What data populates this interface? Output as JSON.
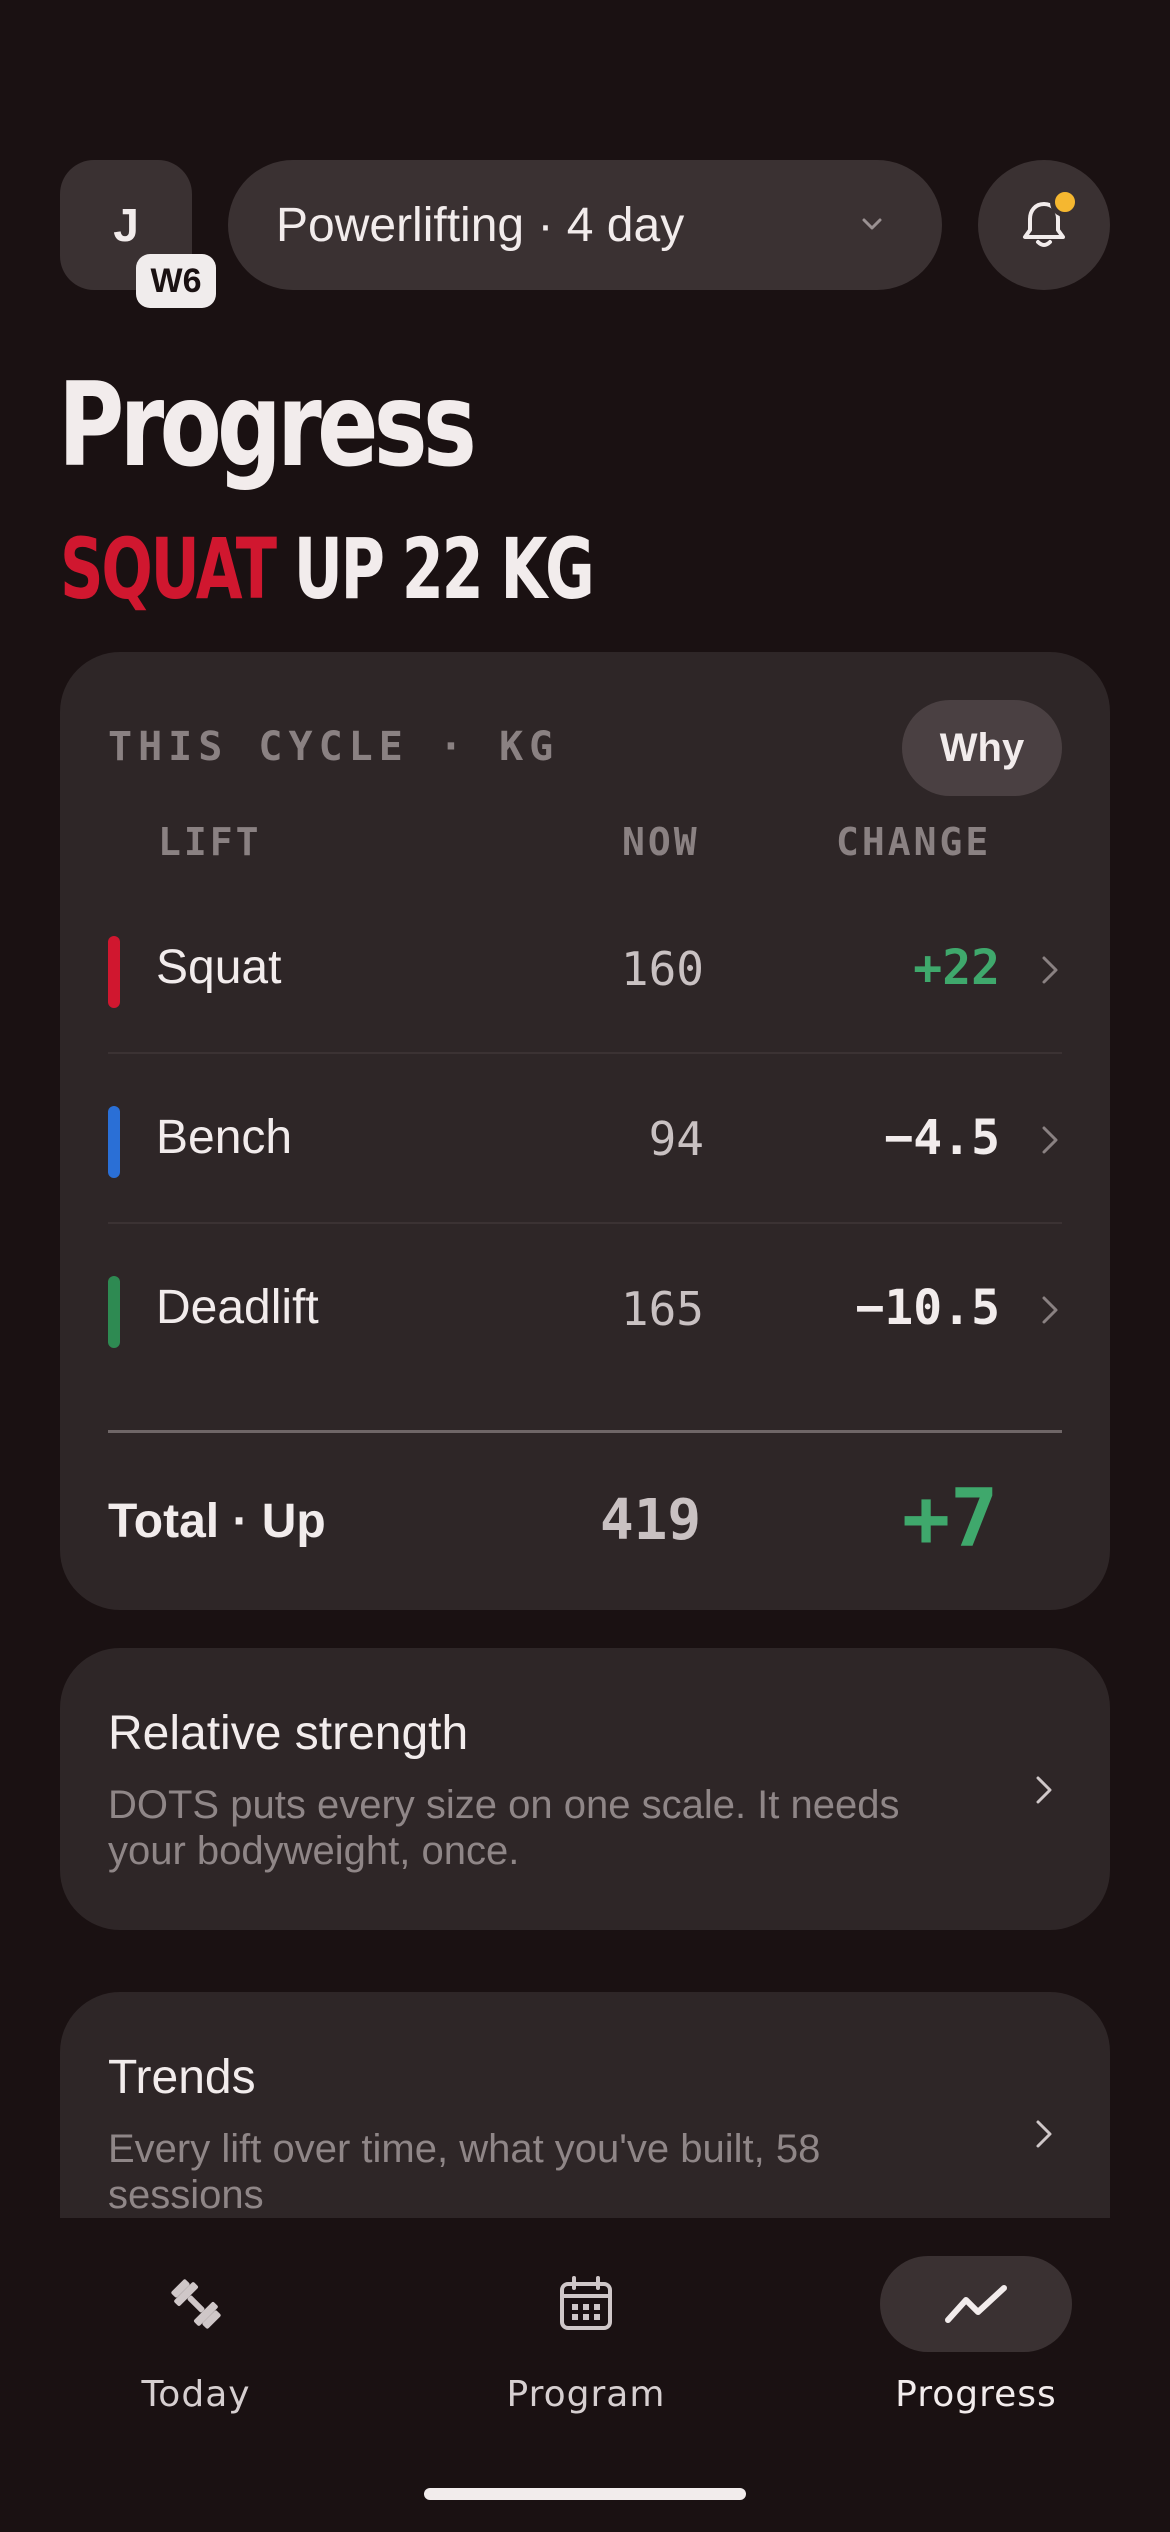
{
  "header": {
    "avatar_initial": "J",
    "week_badge": "W6",
    "program_name": "Powerlifting · 4 day"
  },
  "page_title": "Progress",
  "headline": {
    "lift": "SQUAT",
    "rest": "UP 22 KG"
  },
  "cycle_card": {
    "label": "THIS CYCLE · KG",
    "why_label": "Why",
    "columns": {
      "lift": "LIFT",
      "now": "NOW",
      "change": "CHANGE"
    },
    "lifts": [
      {
        "name": "Squat",
        "now": "160",
        "change": "+22",
        "color": "#d0172f",
        "change_color": "#3fa86c"
      },
      {
        "name": "Bench",
        "now": "94",
        "change": "−4.5",
        "color": "#2a6fd6",
        "change_color": "#f2ecec"
      },
      {
        "name": "Deadlift",
        "now": "165",
        "change": "−10.5",
        "color": "#2e8a52",
        "change_color": "#f2ecec"
      }
    ],
    "total": {
      "label": "Total · Up",
      "now": "419",
      "change": "+7"
    }
  },
  "relative_strength": {
    "title": "Relative strength",
    "description": "DOTS puts every size on one scale. It needs your bodyweight, once."
  },
  "trends": {
    "title": "Trends",
    "description": "Every lift over time, what you've built, 58 sessions"
  },
  "nav": {
    "items": [
      {
        "label": "Today",
        "icon": "dumbbell-icon"
      },
      {
        "label": "Program",
        "icon": "calendar-icon"
      },
      {
        "label": "Progress",
        "icon": "trend-line-icon",
        "active": true
      }
    ]
  },
  "colors": {
    "background": "#1a1112",
    "card": "#2e2627",
    "accent_red": "#d0172f",
    "positive_green": "#3fa86c",
    "notification_dot": "#f5b730"
  }
}
